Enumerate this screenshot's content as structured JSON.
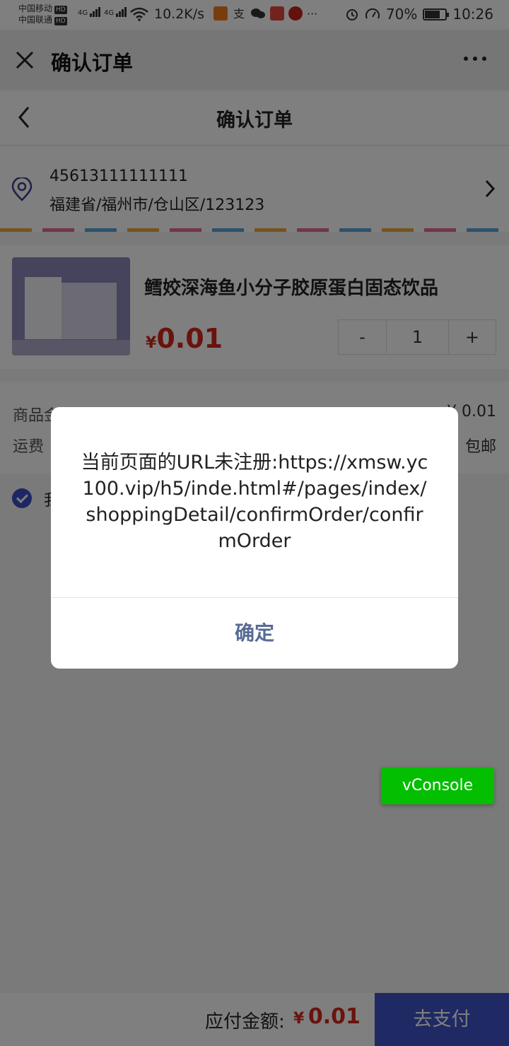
{
  "status_bar": {
    "carrier1": "中国移动",
    "carrier2": "中国联通",
    "hd": "HD",
    "net_type": "4G",
    "speed": "10.2K/s",
    "battery_text": "70%",
    "time": "10:26"
  },
  "titlebar": {
    "title": "确认订单"
  },
  "navbar": {
    "title": "确认订单"
  },
  "address": {
    "phone": "45613111111111",
    "line": "福建省/福州市/仓山区/123123"
  },
  "product": {
    "name": "鳕姣深海鱼小分子胶原蛋白固态饮品",
    "currency": "¥",
    "price": "0.01",
    "quantity": "1",
    "minus_label": "-",
    "plus_label": "+"
  },
  "summary": {
    "goods_label": "商品金额",
    "goods_value": "¥ 0.01",
    "shipping_label": "运费",
    "shipping_value": "包邮"
  },
  "agree": {
    "text": "我"
  },
  "bottom": {
    "label": "应付金额:",
    "currency": "¥",
    "amount": "0.01",
    "pay_button": "去支付"
  },
  "vconsole": {
    "label": "vConsole"
  },
  "dialog": {
    "message": "当前页面的URL未注册:https://xmsw.yc100.vip/h5/inde.html#/pages/index/shoppingDetail/confirmOrder/confirmOrder",
    "ok_label": "确定"
  },
  "colors": {
    "price_red": "#d4261a",
    "accent_blue": "#3f52c8",
    "dialog_button": "#576b95",
    "vconsole_green": "#04be02"
  }
}
